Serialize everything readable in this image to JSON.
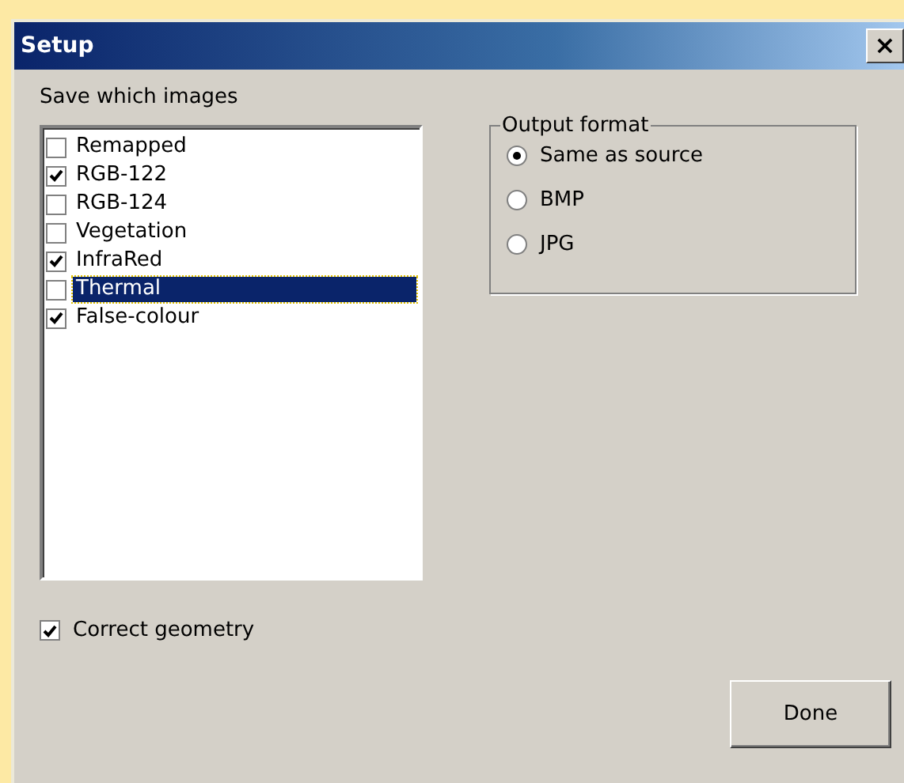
{
  "window": {
    "title": "Setup",
    "close": "×"
  },
  "images": {
    "label": "Save which images",
    "items": [
      {
        "label": "Remapped",
        "checked": false,
        "selected": false
      },
      {
        "label": "RGB-122",
        "checked": true,
        "selected": false
      },
      {
        "label": "RGB-124",
        "checked": false,
        "selected": false
      },
      {
        "label": "Vegetation",
        "checked": false,
        "selected": false
      },
      {
        "label": "InfraRed",
        "checked": true,
        "selected": false
      },
      {
        "label": "Thermal",
        "checked": false,
        "selected": true
      },
      {
        "label": "False-colour",
        "checked": true,
        "selected": false
      }
    ]
  },
  "output_format": {
    "title": "Output format",
    "options": [
      {
        "label": "Same as source",
        "selected": true
      },
      {
        "label": "BMP",
        "selected": false
      },
      {
        "label": "JPG",
        "selected": false
      }
    ]
  },
  "correct_geometry": {
    "label": "Correct geometry",
    "checked": true
  },
  "buttons": [
    "Done"
  ]
}
